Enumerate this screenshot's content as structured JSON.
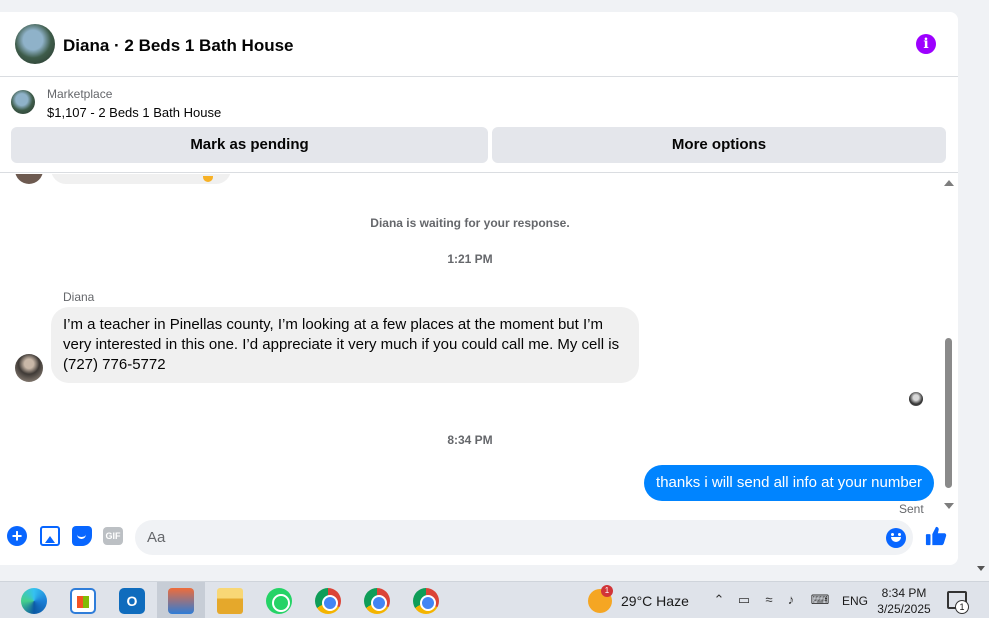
{
  "header": {
    "title": "Diana · 2 Beds 1 Bath House"
  },
  "listing": {
    "source_label": "Marketplace",
    "title": "$1,107 - 2 Beds 1 Bath House",
    "buttons": {
      "pending": "Mark as pending",
      "more": "More options"
    }
  },
  "conversation": {
    "waiting_notice": "Diana is waiting for your response.",
    "time_1": "1:21 PM",
    "sender_name": "Diana",
    "incoming_message": "I’m a teacher in Pinellas county, I’m looking at a few places at the moment but I’m very interested in this one. I’d  appreciate it very much if you could call me. My cell is (727) 776-5772",
    "time_2": "8:34 PM",
    "outgoing_message": "thanks i will send all info at your number",
    "status": "Sent"
  },
  "composer": {
    "placeholder": "Aa",
    "gif_label": "GIF"
  },
  "taskbar": {
    "weather_badge": "1",
    "weather": "29°C  Haze",
    "language": "ENG",
    "time": "8:34 PM",
    "date": "3/25/2025",
    "notification_count": "1"
  },
  "colors": {
    "accent": "#0866ff",
    "outgoing_bubble": "#0084ff",
    "info_icon": "#9d00ff"
  }
}
